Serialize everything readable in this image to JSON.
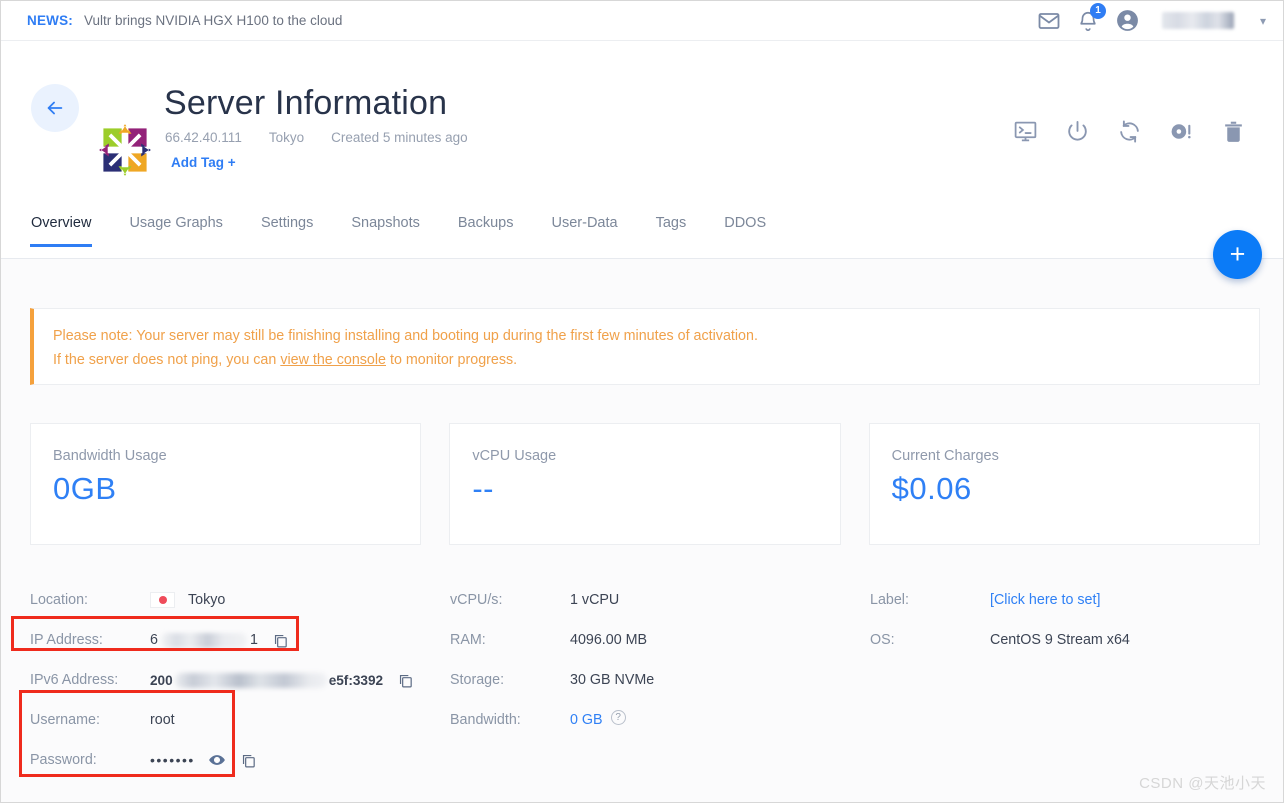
{
  "newsbar": {
    "label": "NEWS:",
    "text": "Vultr brings NVIDIA HGX H100 to the cloud",
    "mail_icon": "mail-icon",
    "bell_icon": "bell-icon",
    "notification_count": "1",
    "account_icon": "account-circle-icon",
    "chevron": "▾"
  },
  "header": {
    "back_icon": "arrow-left-icon",
    "os_logo": "centos-logo-icon",
    "title": "Server Information",
    "meta": [
      "66.42.40.111",
      "Tokyo",
      "Created 5 minutes ago"
    ],
    "add_tag": "Add Tag +",
    "actions": [
      {
        "name": "view-console-icon",
        "title": "View Console"
      },
      {
        "name": "power-icon",
        "title": "Power"
      },
      {
        "name": "restart-icon",
        "title": "Restart"
      },
      {
        "name": "reinstall-icon",
        "title": "Reinstall"
      },
      {
        "name": "delete-icon",
        "title": "Destroy"
      }
    ]
  },
  "tabs": [
    {
      "label": "Overview",
      "active": true
    },
    {
      "label": "Usage Graphs",
      "active": false
    },
    {
      "label": "Settings",
      "active": false
    },
    {
      "label": "Snapshots",
      "active": false
    },
    {
      "label": "Backups",
      "active": false
    },
    {
      "label": "User-Data",
      "active": false
    },
    {
      "label": "Tags",
      "active": false
    },
    {
      "label": "DDOS",
      "active": false
    }
  ],
  "fab": {
    "label": "+"
  },
  "notice": {
    "line1": "Please note: Your server may still be finishing installing and booting up during the first few minutes of activation.",
    "line2_before": "If the server does not ping, you can ",
    "link": "view the console",
    "line2_after": " to monitor progress."
  },
  "cards": [
    {
      "label": "Bandwidth Usage",
      "value": "0GB"
    },
    {
      "label": "vCPU Usage",
      "value": "--"
    },
    {
      "label": "Current Charges",
      "value": "$0.06"
    }
  ],
  "details": {
    "col1": {
      "location_label": "Location:",
      "location_value": "Tokyo",
      "ip_label": "IP Address:",
      "ip_prefix": "6",
      "ip_suffix": "1",
      "ipv6_label": "IPv6 Address:",
      "ipv6_prefix": "200",
      "ipv6_suffix": "e5f:3392",
      "username_label": "Username:",
      "username_value": "root",
      "password_label": "Password:",
      "password_value": "•••••••"
    },
    "col2": {
      "vcpu_label": "vCPU/s:",
      "vcpu_value": "1 vCPU",
      "ram_label": "RAM:",
      "ram_value": "4096.00 MB",
      "storage_label": "Storage:",
      "storage_value": "30 GB NVMe",
      "bandwidth_label": "Bandwidth:",
      "bandwidth_value": "0 GB",
      "bandwidth_help": "?"
    },
    "col3": {
      "label_label": "Label:",
      "label_value": "[Click here to set]",
      "os_label": "OS:",
      "os_value": "CentOS 9 Stream x64"
    }
  },
  "watermark": "CSDN @天池小天",
  "colors": {
    "accent_blue": "#2f7df4",
    "notice_orange": "#f0a14a",
    "annotation_red": "#ef2b1d",
    "text_dark": "#28334a",
    "text_muted": "#8a95a6"
  }
}
